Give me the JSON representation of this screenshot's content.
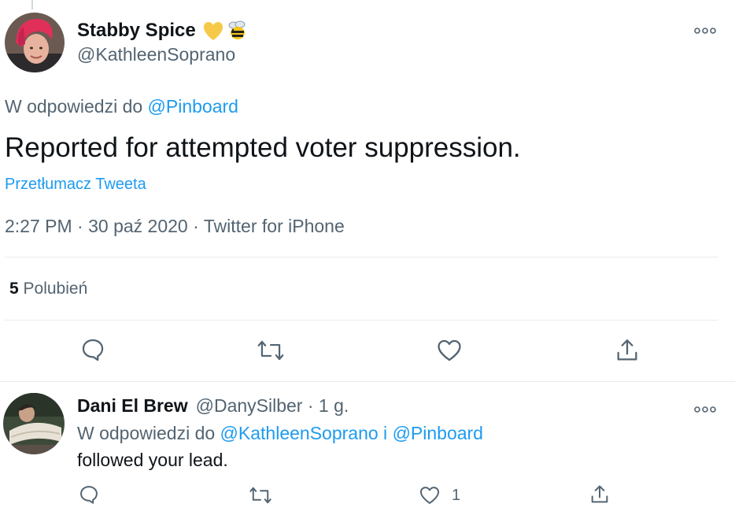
{
  "main_tweet": {
    "author_name": "Stabby Spice",
    "author_handle": "@KathleenSoprano",
    "emojis": [
      "yellow-heart",
      "bee"
    ],
    "reply_prefix": "W odpowiedzi do",
    "reply_to": "@Pinboard",
    "text": "Reported for attempted voter suppression.",
    "translate_label": "Przetłumacz Tweeta",
    "time": "2:27 PM",
    "date": "30 paź 2020",
    "source": "Twitter for iPhone",
    "likes_count": "5",
    "likes_label": "Polubień",
    "actions": [
      "reply-icon",
      "retweet-icon",
      "like-icon",
      "share-icon"
    ]
  },
  "reply_tweet": {
    "author_name": "Dani El Brew",
    "author_handle": "@DanySilber",
    "age": "1 g.",
    "reply_prefix": "W odpowiedzi do",
    "reply_to_1": "@KathleenSoprano",
    "reply_connector": "i",
    "reply_to_2": "@Pinboard",
    "text": "followed your lead.",
    "like_count": "1",
    "actions": [
      "reply-icon",
      "retweet-icon",
      "like-icon",
      "share-icon"
    ]
  },
  "colors": {
    "text": "#0f1419",
    "muted": "#536471",
    "link": "#1d9bf0",
    "divider": "#e6ecf0",
    "avatar_hair": "#e0305a"
  }
}
